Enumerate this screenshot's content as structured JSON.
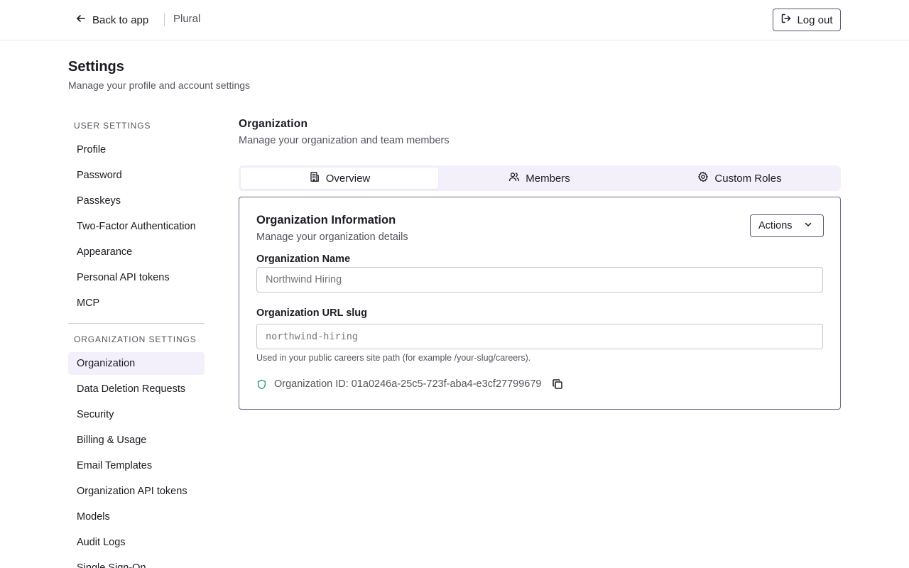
{
  "topbar": {
    "back_label": "Back to app",
    "brand": "Plural",
    "logout_label": "Log out"
  },
  "page": {
    "title": "Settings",
    "subtitle": "Manage your profile and account settings"
  },
  "sidebar": {
    "user_group_title": "USER SETTINGS",
    "user_items": [
      {
        "label": "Profile"
      },
      {
        "label": "Password"
      },
      {
        "label": "Passkeys"
      },
      {
        "label": "Two-Factor Authentication"
      },
      {
        "label": "Appearance"
      },
      {
        "label": "Personal API tokens"
      },
      {
        "label": "MCP"
      }
    ],
    "org_group_title": "ORGANIZATION SETTINGS",
    "org_items": [
      {
        "label": "Organization",
        "active": true
      },
      {
        "label": "Data Deletion Requests"
      },
      {
        "label": "Security"
      },
      {
        "label": "Billing & Usage"
      },
      {
        "label": "Email Templates"
      },
      {
        "label": "Organization API tokens"
      },
      {
        "label": "Models"
      },
      {
        "label": "Audit Logs"
      },
      {
        "label": "Single Sign-On"
      }
    ]
  },
  "section": {
    "title": "Organization",
    "subtitle": "Manage your organization and team members"
  },
  "tabs": [
    {
      "label": "Overview",
      "icon": "building-icon",
      "active": true
    },
    {
      "label": "Members",
      "icon": "users-icon"
    },
    {
      "label": "Custom Roles",
      "icon": "gear-icon"
    }
  ],
  "card": {
    "title": "Organization Information",
    "subtitle": "Manage your organization details",
    "actions_label": "Actions",
    "name_label": "Organization Name",
    "name_placeholder": "Northwind Hiring",
    "slug_label": "Organization URL slug",
    "slug_placeholder": "northwind-hiring",
    "slug_help": "Used in your public careers site path (for example /your-slug/careers).",
    "org_id_text": "Organization ID: 01a0246a-25c5-723f-aba4-e3cf27799679"
  },
  "colors": {
    "accent_bg": "#f3f0fc",
    "border_accent": "#6b6886",
    "shield_green": "#2f9e6e",
    "text_primary": "#1c1b22",
    "text_muted": "#55545e"
  }
}
